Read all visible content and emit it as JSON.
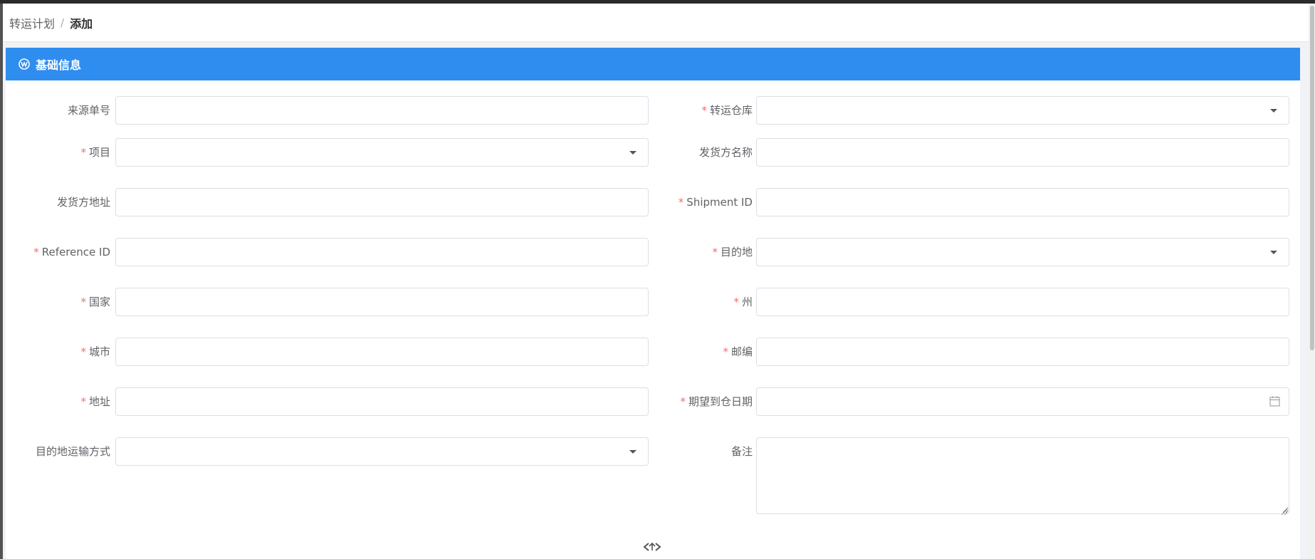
{
  "breadcrumb": {
    "parent": "转运计划",
    "separator": "/",
    "current": "添加"
  },
  "section": {
    "title": "基础信息",
    "icon": "section-logo-icon"
  },
  "fields": {
    "source_no": {
      "label": "来源单号",
      "required": false,
      "type": "text",
      "value": ""
    },
    "warehouse": {
      "label": "转运仓库",
      "required": true,
      "type": "select",
      "value": ""
    },
    "project": {
      "label": "项目",
      "required": true,
      "type": "select",
      "value": ""
    },
    "shipper_name": {
      "label": "发货方名称",
      "required": false,
      "type": "text",
      "value": ""
    },
    "shipper_address": {
      "label": "发货方地址",
      "required": false,
      "type": "text",
      "value": ""
    },
    "shipment_id": {
      "label": "Shipment ID",
      "required": true,
      "type": "text",
      "value": ""
    },
    "reference_id": {
      "label": "Reference ID",
      "required": true,
      "type": "text",
      "value": ""
    },
    "destination": {
      "label": "目的地",
      "required": true,
      "type": "select",
      "value": ""
    },
    "country": {
      "label": "国家",
      "required": true,
      "type": "text",
      "value": ""
    },
    "state": {
      "label": "州",
      "required": true,
      "type": "text",
      "value": ""
    },
    "city": {
      "label": "城市",
      "required": true,
      "type": "text",
      "value": ""
    },
    "zip": {
      "label": "邮编",
      "required": true,
      "type": "text",
      "value": ""
    },
    "address": {
      "label": "地址",
      "required": true,
      "type": "text",
      "value": ""
    },
    "expected_date": {
      "label": "期望到仓日期",
      "required": true,
      "type": "date",
      "value": ""
    },
    "transport_mode": {
      "label": "目的地运输方式",
      "required": false,
      "type": "select",
      "value": ""
    },
    "remark": {
      "label": "备注",
      "required": false,
      "type": "textarea",
      "value": ""
    }
  },
  "required_mark": "*",
  "colors": {
    "header_bg": "#2f8df0",
    "required": "#f56c6c",
    "border": "#dcdfe6"
  }
}
